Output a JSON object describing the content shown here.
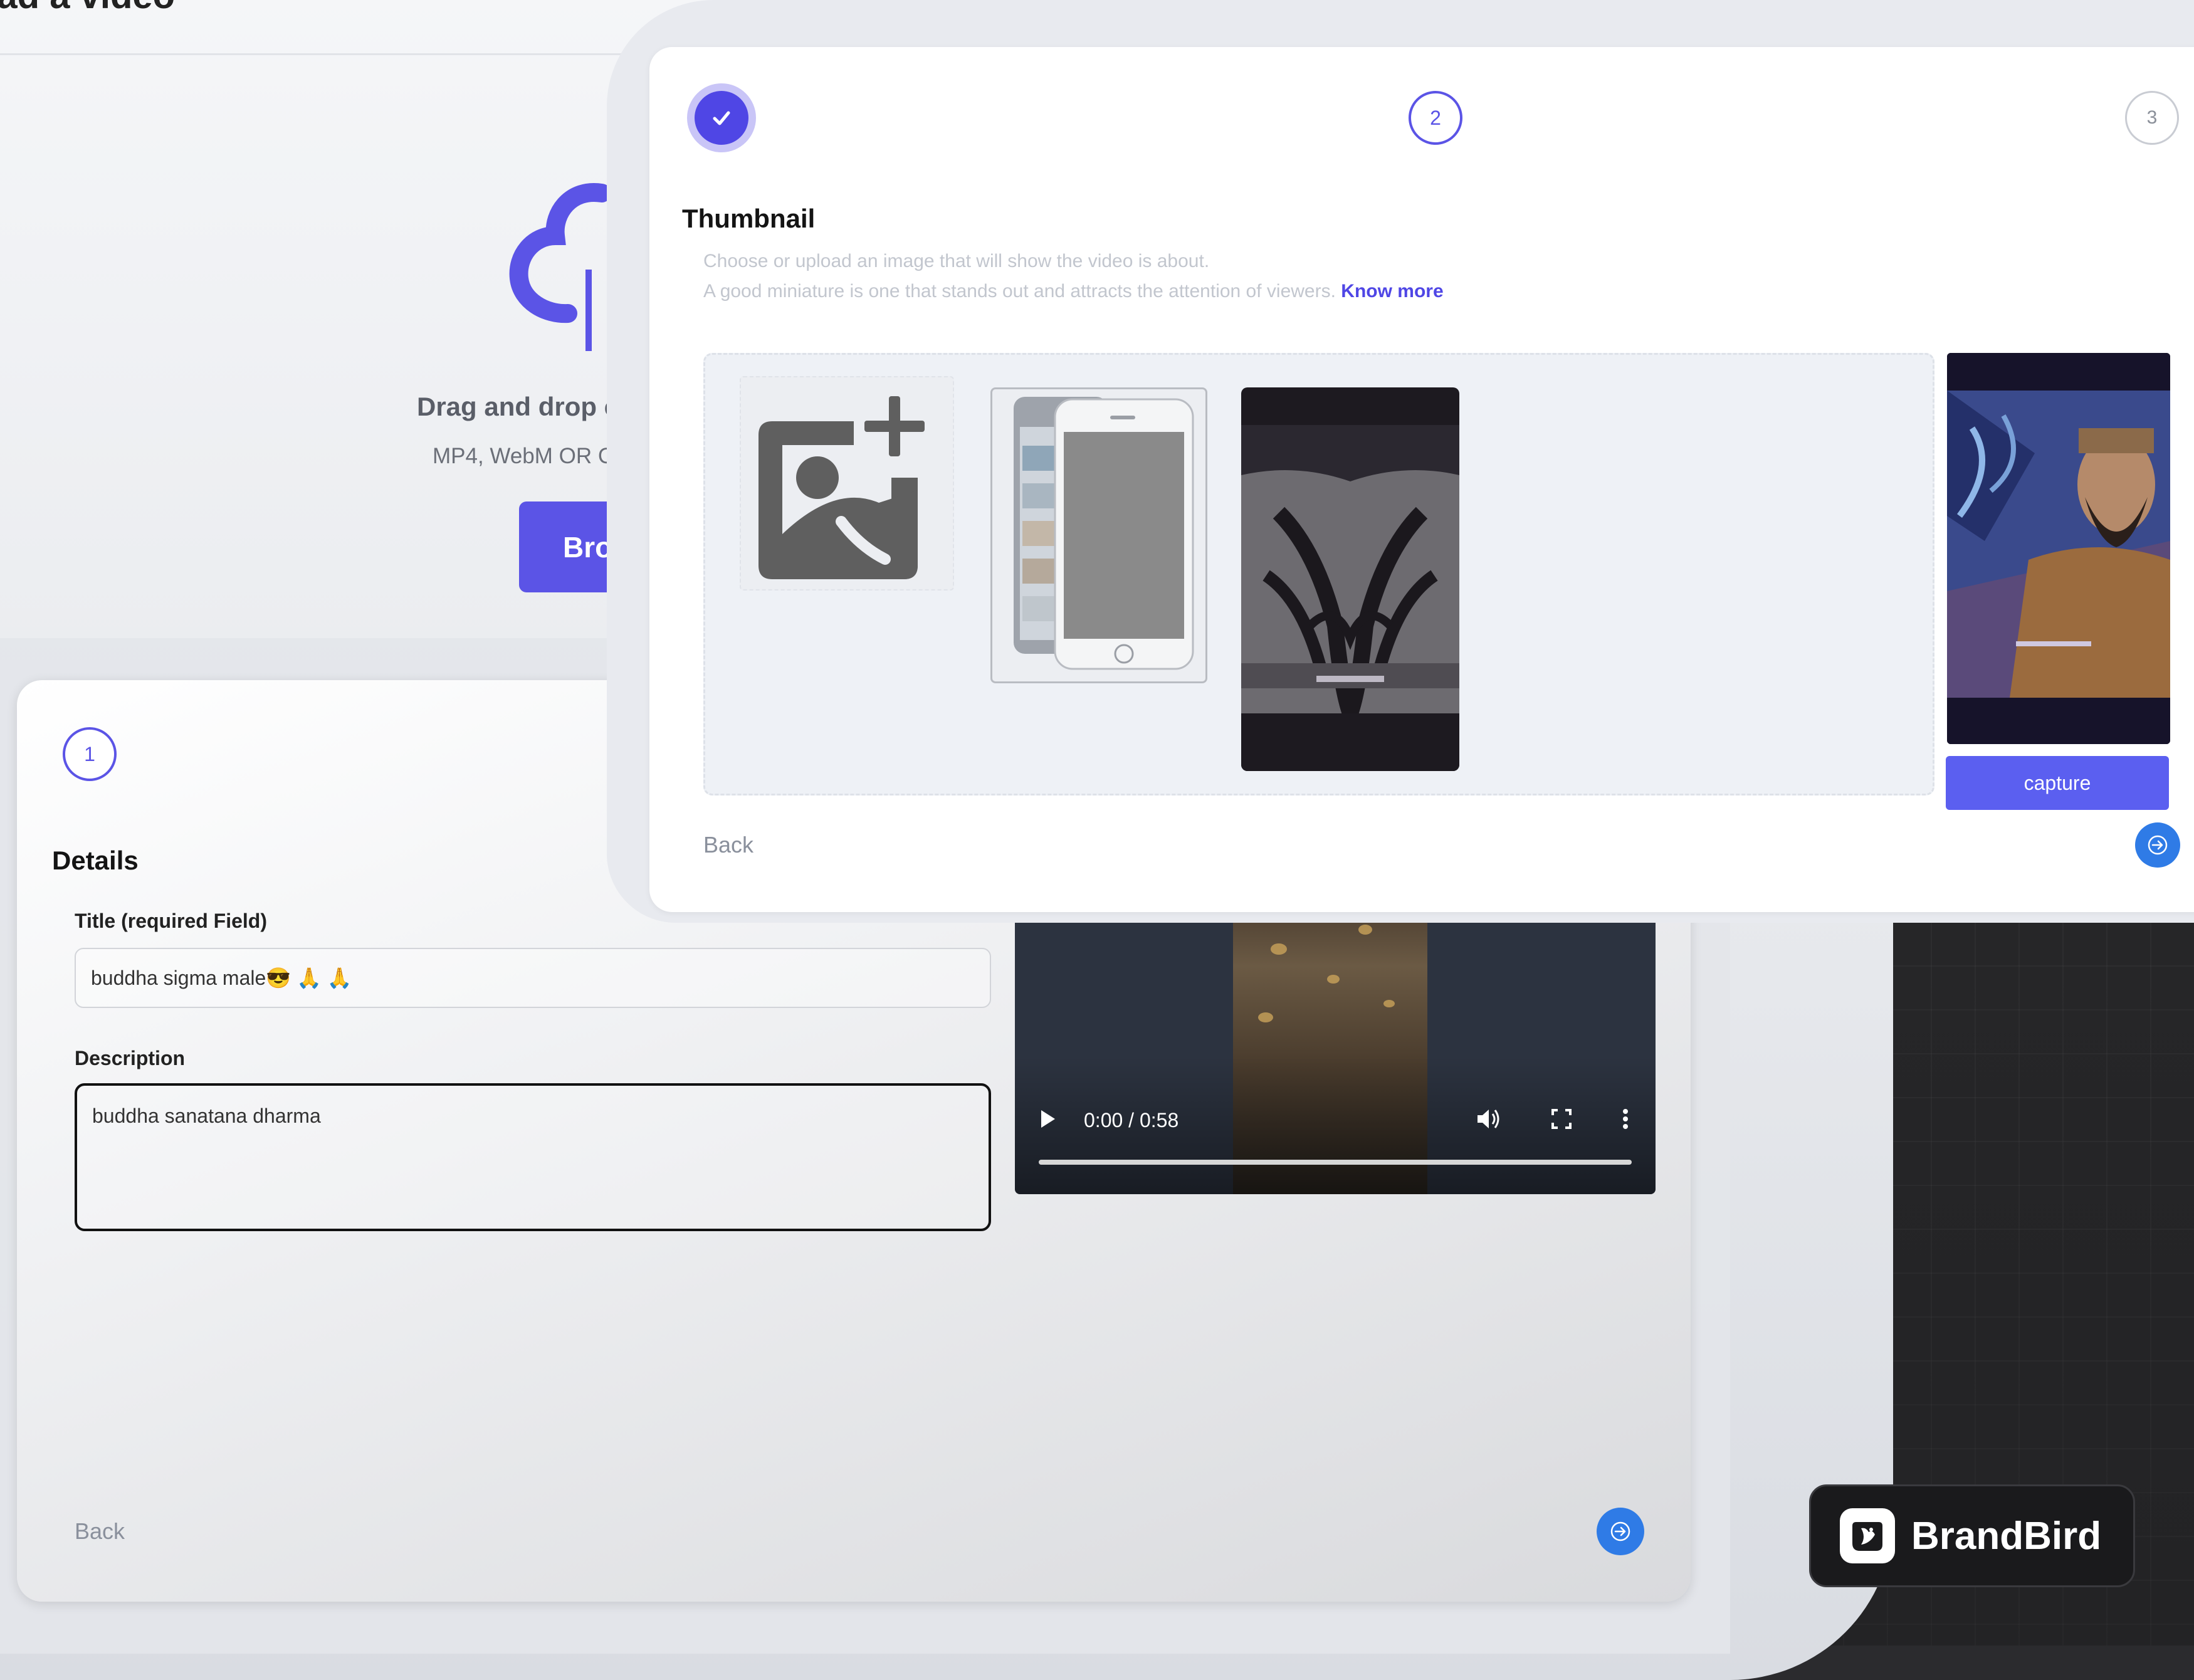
{
  "upload": {
    "title": "oad a video",
    "drag_text": "Drag and drop c",
    "formats_text": "MP4, WebM OR C",
    "browse_label": "Bro"
  },
  "details": {
    "step_number": "1",
    "section_title": "Details",
    "title_label": "Title (required Field)",
    "title_value": "buddha sigma male😎 🙏 🙏",
    "description_label": "Description",
    "description_value": "buddha sanatana dharma",
    "back_label": "Back"
  },
  "video": {
    "time": "0:00 / 0:58",
    "progress": 0
  },
  "thumbnail": {
    "step2_number": "2",
    "step3_number": "3",
    "section_title": "Thumbnail",
    "desc_line1": "Choose or upload an image that will show the video is about.",
    "desc_line2": "A good miniature is one that stands out and attracts the attention of viewers.",
    "know_more": "Know more",
    "capture_label": "capture",
    "back_label": "Back"
  },
  "brand": {
    "name": "BrandBird"
  },
  "colors": {
    "accent": "#5b54e6",
    "fab": "#2f7be6",
    "capture": "#5b5ff0"
  },
  "icons": [
    "cloud-upload-icon",
    "check-icon",
    "add-image-icon",
    "arrow-right-icon",
    "play-icon",
    "volume-icon",
    "fullscreen-icon",
    "more-vertical-icon",
    "brandbird-logo-icon"
  ]
}
